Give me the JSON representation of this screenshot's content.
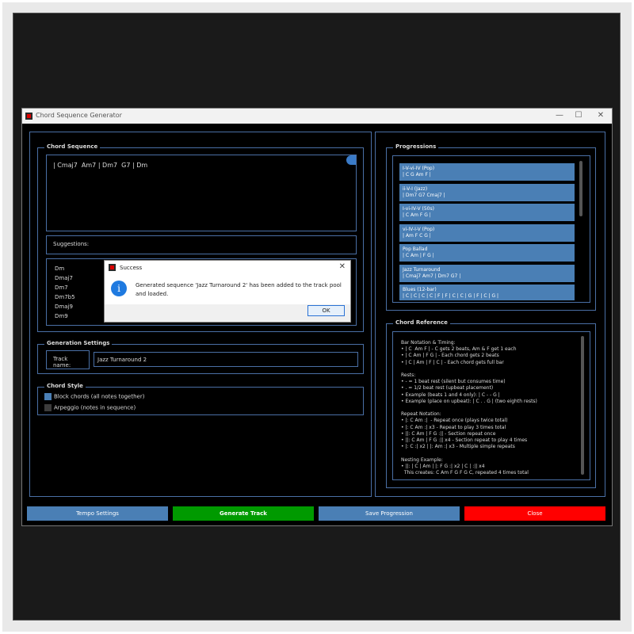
{
  "window": {
    "title": "Chord Sequence Generator",
    "controls": {
      "minimize": "—",
      "maximize": "☐",
      "close": "✕"
    }
  },
  "chord_sequence": {
    "label": "Chord Sequence",
    "text": "| Cmaj7  Am7 | Dm7  G7 | Dm"
  },
  "suggestions": {
    "label": "Suggestions:",
    "items": [
      "Dm",
      "Dmaj7",
      "Dm7",
      "Dm7b5",
      "Dmaj9",
      "Dm9"
    ]
  },
  "generation": {
    "label": "Generation Settings",
    "track_label": "Track name:",
    "track_value": "Jazz Turnaround 2"
  },
  "chord_style": {
    "label": "Chord Style",
    "options": [
      {
        "label": "Block chords (all notes together)",
        "color": "#4a7fb5"
      },
      {
        "label": "Arpeggio (notes in sequence)",
        "color": "#3c3c3c"
      }
    ]
  },
  "progressions": {
    "label": "Progressions",
    "items": [
      {
        "name": "I-V-vi-IV (Pop)",
        "chords": "| C G Am F |"
      },
      {
        "name": "ii-V-I (Jazz)",
        "chords": "| Dm7 G7 Cmaj7 |"
      },
      {
        "name": "I-vi-IV-V (50s)",
        "chords": "| C Am F G |"
      },
      {
        "name": "vi-IV-I-V (Pop)",
        "chords": "| Am F C G |"
      },
      {
        "name": "Pop Ballad",
        "chords": "| C  Am | F  G |"
      },
      {
        "name": "Jazz Turnaround",
        "chords": "| Cmaj7  Am7 | Dm7  G7 |"
      },
      {
        "name": "Blues (12-bar)",
        "chords": "| C | C | C | C | F | F | C | C | G | F | C | G |"
      }
    ]
  },
  "reference": {
    "label": "Chord Reference",
    "text": "Bar Notation & Timing:\n• | C  Am F | - C gets 2 beats, Am & F get 1 each\n• | C Am | F G | - Each chord gets 2 beats\n• | C | Am | F | C | - Each chord gets full bar\n\nRests:\n• - = 1 beat rest (silent but consumes time)\n• . = 1/2 beat rest (upbeat placement)\n• Example (beats 1 and 4 only): | C - - G |\n• Example (place on upbeat): | C . . G | (two eighth rests)\n\nRepeat Notation:\n• |: C Am :|  - Repeat once (plays twice total)\n• |: C Am :| x3 - Repeat to play 3 times total\n• ||: C Am | F G :|| - Section repeat once\n• ||: C Am | F G :|| x4 - Section repeat to play 4 times\n• |: C :| x2 | |: Am :| x3 - Multiple simple repeats\n\nNesting Example:\n• ||: | C | Am | |: F G :| x2 | C | :|| x4\n  This creates: C Am F G F G C, repeated 4 times total"
  },
  "buttons": {
    "tempo": "Tempo Settings",
    "generate": "Generate Track",
    "save": "Save Progression",
    "close": "Close"
  },
  "colors": {
    "tempo": "#4a7fb5",
    "generate": "#009a00",
    "save": "#4a7fb5",
    "close": "#ff0000",
    "accent_border": "#4a6fa5"
  },
  "dialog": {
    "title": "Success",
    "message": "Generated sequence 'Jazz Turnaround 2' has been added to the track pool and loaded.",
    "ok": "OK",
    "close": "✕",
    "icon": "i"
  }
}
